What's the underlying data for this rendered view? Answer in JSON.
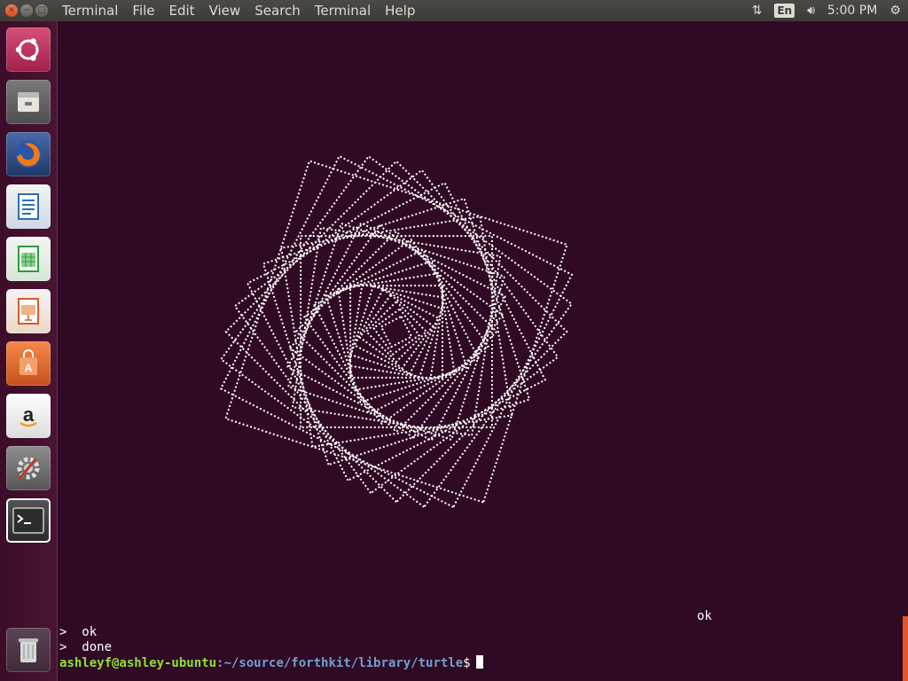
{
  "topbar": {
    "menus": [
      "Terminal",
      "File",
      "Edit",
      "View",
      "Search",
      "Terminal",
      "Help"
    ],
    "keyboard_layout": "En",
    "time": "5:00 PM"
  },
  "launcher": {
    "items": [
      {
        "name": "ubuntu-dash-icon",
        "color": "#d33a62"
      },
      {
        "name": "files-icon",
        "color": "#a8a8a8"
      },
      {
        "name": "firefox-icon",
        "color": "#e66000"
      },
      {
        "name": "libreoffice-writer-icon",
        "color": "#2a6fb3"
      },
      {
        "name": "libreoffice-calc-icon",
        "color": "#2e9a3d"
      },
      {
        "name": "libreoffice-impress-icon",
        "color": "#d0602a"
      },
      {
        "name": "software-center-icon",
        "color": "#e46b2b"
      },
      {
        "name": "amazon-icon",
        "color": "#ffffff"
      },
      {
        "name": "system-settings-icon",
        "color": "#8a8a8a"
      },
      {
        "name": "terminal-icon",
        "color": "#2d2d2d"
      },
      {
        "name": "trash-icon",
        "color": "#9a9a9a"
      }
    ]
  },
  "terminal": {
    "ok_right": "ok",
    "line1": ">  ok",
    "line2": ">  done",
    "prompt_user": "ashleyf@ashley-ubuntu",
    "prompt_path": ":~/source/forthkit/library/turtle",
    "prompt_symbol": "$"
  }
}
